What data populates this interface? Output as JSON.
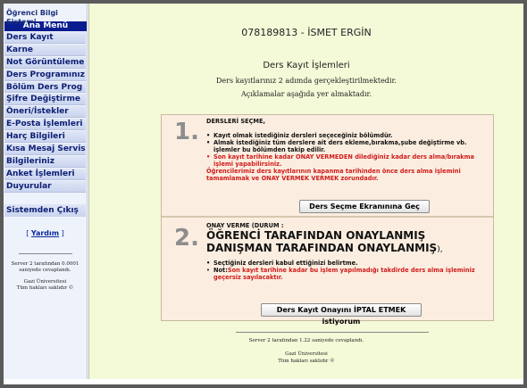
{
  "sidebar": {
    "title": "Öğrenci Bilgi Sistemi",
    "header": "Ana Menü",
    "items": [
      {
        "label": "Ders Kayıt"
      },
      {
        "label": "Karne"
      },
      {
        "label": "Not Görüntüleme"
      },
      {
        "label": "Ders Programınız"
      },
      {
        "label": "Bölüm Ders Prog"
      },
      {
        "label": "Şifre Değiştirme"
      },
      {
        "label": "Öneri/İstekler"
      },
      {
        "label": "E-Posta İşlemleri"
      },
      {
        "label": "Harç Bilgileri"
      },
      {
        "label": "Kısa Mesaj Servisi"
      },
      {
        "label": "Bilgileriniz"
      },
      {
        "label": "Anket İşlemleri"
      },
      {
        "label": "Duyurular"
      }
    ],
    "exit_label": "Sistemden Çıkış",
    "help_open": "[",
    "help_label": "Yardım",
    "help_close": "]",
    "footer_line1": "Server 2 tarafından 0.0001 saniyede cevaplandı.",
    "footer_line2": "Gazi Üniversitesi",
    "footer_line3": "Tüm hakları saklıdır ©"
  },
  "main": {
    "student": "078189813 - İSMET ERGİN",
    "heading": "Ders Kayıt İşlemleri",
    "sub1": "Ders kayıtlarınız 2 adımda gerçekleştirilmektedir.",
    "sub2": "Açıklamalar aşağıda yer almaktadır.",
    "step1": {
      "number": "1.",
      "title": "DERSLERİ SEÇME,",
      "b1": "Kayıt olmak istediğiniz dersleri seçeceğiniz bölümdür.",
      "b2": "Almak istediğiniz tüm derslere ait ders ekleme,bırakma,şube değiştirme vb. işlemler bu bölümden takip edilir.",
      "b3": "Son kayıt tarihine kadar ONAY VERMEDEN dilediğiniz kadar ders alma/bırakma işlemi yapabilirsiniz.",
      "b3_cont": "Öğrencilerimiz ders kayıtlarının kapanma tarihinden önce ders alma işlemini tamamlamak ve ONAY VERMEK VERMEK zorundadır.",
      "button": "Ders Seçme Ekranınına Geç"
    },
    "step2": {
      "number": "2.",
      "title": "ONAY VERME (DURUM :",
      "big1": "ÖĞRENCİ TARAFINDAN ONAYLANMIŞ",
      "big2": "DANIŞMAN TARAFINDAN ONAYLANMIŞ",
      "big2_tail": "),",
      "b1": "Seçtiğiniz dersleri kabul ettiğinizi belirtme.",
      "b2_prefix": "Not:",
      "b2": "Son kayıt tarihine kadar bu işlem yapılmadığı takdirde ders alma işleminiz geçersiz sayılacaktır.",
      "button": "Ders Kayıt Onayını İPTAL ETMEK istiyorum"
    },
    "footer_line1": "Server 2 tarafından 1.22 saniyede cevaplandı.",
    "footer_line2": "Gazi Üniversitesi",
    "footer_line3": "Tüm hakları saklıdır ©"
  }
}
